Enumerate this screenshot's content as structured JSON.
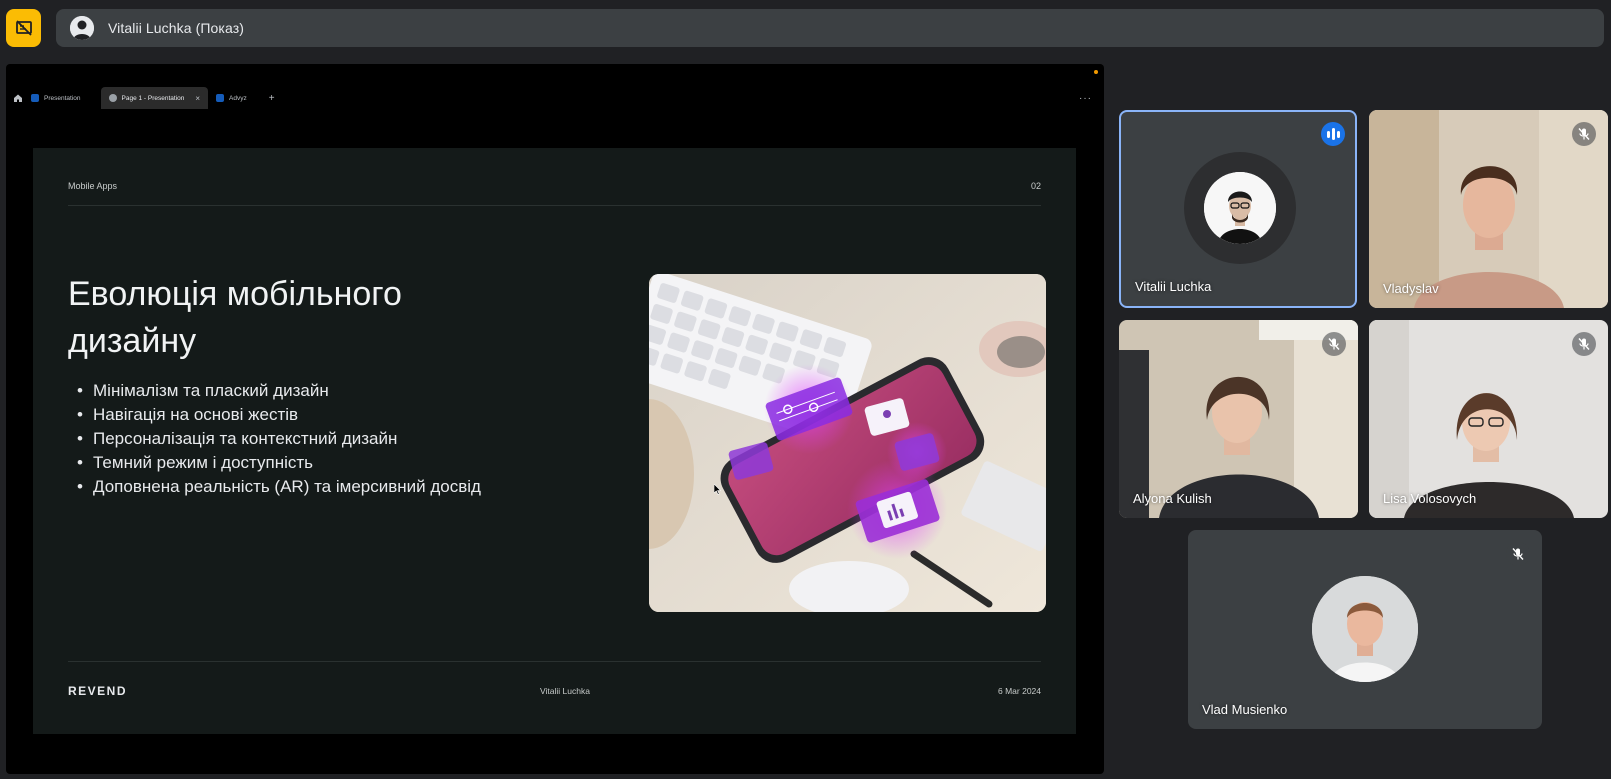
{
  "app": {
    "icon": "stop-presenting-icon",
    "accent_color": "#fbbc04"
  },
  "top_bar": {
    "title": "Vitalii Luchka (Показ)"
  },
  "presentation": {
    "tabs": [
      {
        "label": "Presentation",
        "active": false
      },
      {
        "label": "Page 1 - Presentation",
        "active": true
      },
      {
        "label": "Advyz",
        "active": false
      }
    ],
    "tab_close": "×",
    "tab_add": "+",
    "tab_more": "···",
    "slide": {
      "section": "Mobile Apps",
      "page_number": "02",
      "title": "Еволюція мобільного дизайну",
      "bullets": [
        "Мінімалізм та плаский дизайн",
        "Навігація на основі жестів",
        "Персоналізація та контекстний дизайн",
        "Темний режим і доступність",
        "Доповнена реальність (AR) та імерсивний досвід"
      ],
      "footer_brand": "REVEND",
      "footer_author": "Vitalii Luchka",
      "footer_date": "6 Mar 2024"
    }
  },
  "participants": [
    {
      "name": "Vitalii Luchka",
      "status": "speaking"
    },
    {
      "name": "Vladyslav",
      "status": "muted"
    },
    {
      "name": "Alyona Kulish",
      "status": "muted"
    },
    {
      "name": "Lisa Volosovych",
      "status": "muted"
    },
    {
      "name": "Vlad Musienko",
      "status": "muted"
    }
  ]
}
